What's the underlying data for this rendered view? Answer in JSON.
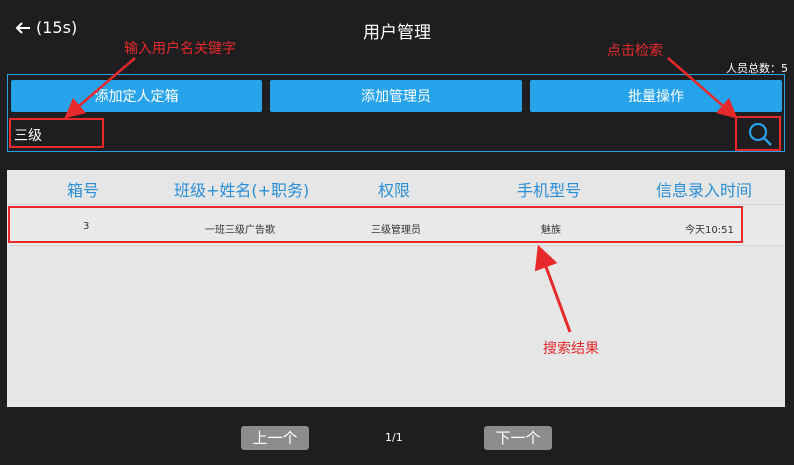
{
  "header": {
    "back_label": "(15s)",
    "title": "用户管理"
  },
  "summary": {
    "total_label": "人员总数：5"
  },
  "toolbar": {
    "add_box_label": "添加定人定箱",
    "add_admin_label": "添加管理员",
    "batch_label": "批量操作"
  },
  "search": {
    "value": "三级",
    "placeholder": ""
  },
  "table": {
    "headers": [
      "箱号",
      "班级+姓名(+职务)",
      "权限",
      "手机型号",
      "信息录入时间"
    ],
    "rows": [
      [
        "3",
        "一班三级广告歌",
        "三级管理员",
        "魅族",
        "今天10:51"
      ]
    ]
  },
  "pagination": {
    "prev_label": "上一个",
    "page_info": "1/1",
    "next_label": "下一个"
  },
  "annotations": {
    "input_hint": "输入用户名关键字",
    "search_hint": "点击检索",
    "result_hint": "搜索结果"
  },
  "colors": {
    "accent": "#27a3ec",
    "annotation": "#e8292b",
    "background": "#1e1e20"
  }
}
